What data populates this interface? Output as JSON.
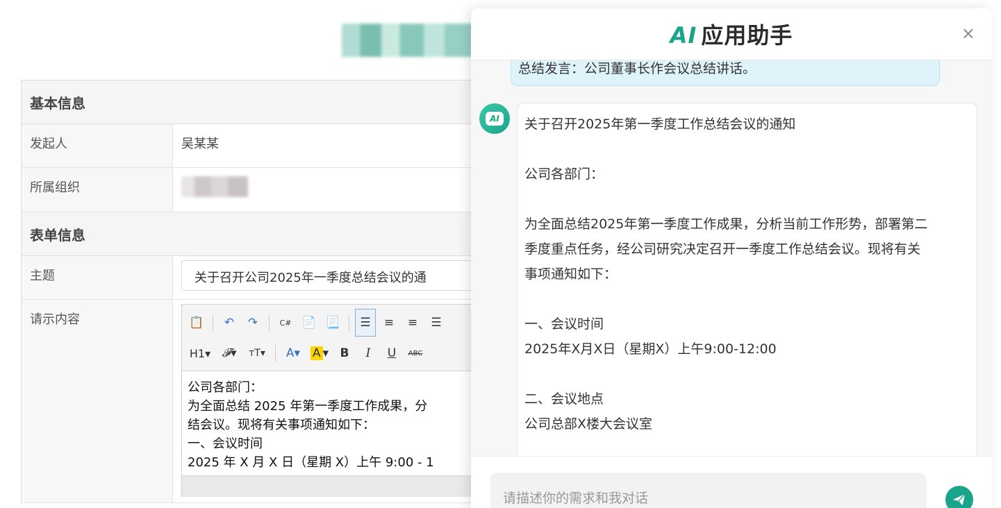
{
  "form": {
    "section_basic": "基本信息",
    "initiator_label": "发起人",
    "initiator_value": "吴某某",
    "org_label": "所属组织",
    "section_form": "表单信息",
    "subject_label": "主题",
    "subject_value": "关于召开公司2025年一季度总结会议的通",
    "content_label": "请示内容",
    "editor_lines": [
      "公司各部门：",
      "为全面总结 2025 年第一季度工作成果，分",
      "结会议。现将有关事项通知如下：",
      "一、会议时间",
      "2025 年 X 月 X 日（星期 X）上午 9:00 - 1"
    ],
    "toolbar_icons": [
      "clipboard-icon",
      "undo-icon",
      "redo-icon",
      "code-icon",
      "paste-text-icon",
      "paste-word-icon",
      "align-left-icon",
      "align-center-icon",
      "align-right-icon",
      "align-justify-icon",
      "heading-icon",
      "font-family-icon",
      "font-size-icon",
      "font-color-icon",
      "highlight-icon",
      "bold-icon",
      "italic-icon",
      "underline-icon",
      "strikethrough-icon",
      "more-icon"
    ]
  },
  "ai_panel": {
    "title_ai": "AI",
    "title_rest": "应用助手",
    "close_symbol": "×",
    "user_message_tail": "总结发言：公司董事长作会议总结讲话。",
    "avatar_text": "AI",
    "reply_lines": [
      "关于召开2025年第一季度工作总结会议的通知",
      "",
      "公司各部门：",
      "",
      "为全面总结2025年第一季度工作成果，分析当前工作形势，部署第二",
      "季度重点任务，经公司研究决定召开一季度工作总结会议。现将有关",
      "事项通知如下：",
      "",
      "一、会议时间",
      "2025年X月X日（星期X）上午9:00-12:00",
      "",
      "二、会议地点",
      "公司总部X楼大会议室"
    ],
    "input_placeholder": "请描述你的需求和我对话"
  },
  "colors": {
    "accent": "#18a58a",
    "user_bubble": "#dff3fb"
  }
}
